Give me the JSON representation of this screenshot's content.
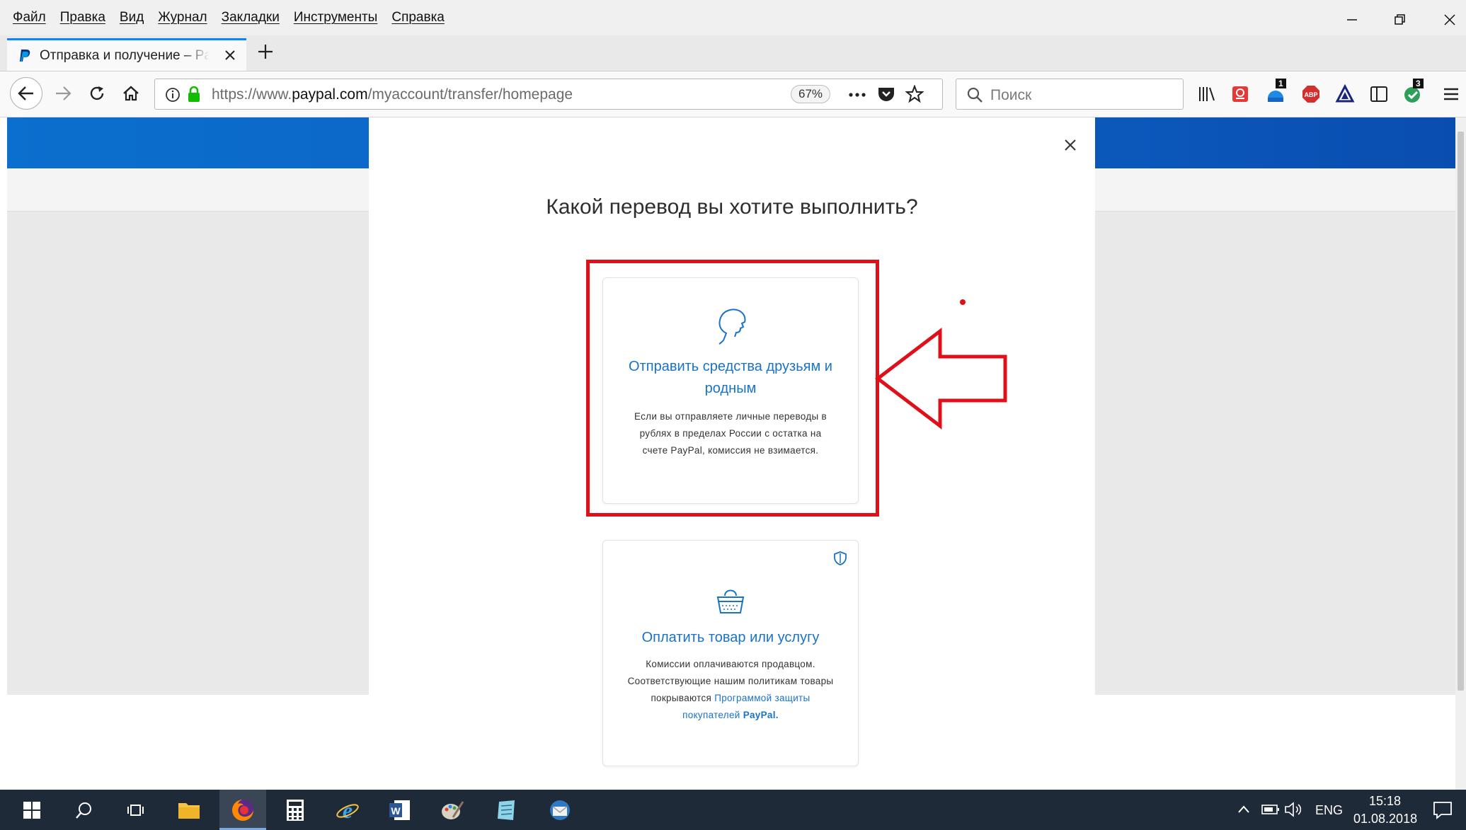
{
  "menu": {
    "items": [
      "Файл",
      "Правка",
      "Вид",
      "Журнал",
      "Закладки",
      "Инструменты",
      "Справка"
    ]
  },
  "tab": {
    "title": "Отправка и получение – PayPal"
  },
  "navbar": {
    "url_prefix": "https://www.",
    "url_domain": "paypal.com",
    "url_path": "/myaccount/transfer/homepage",
    "zoom": "67%",
    "search_placeholder": "Поиск",
    "badges": {
      "ext1": "1",
      "ext2": "3"
    }
  },
  "modal": {
    "title": "Какой перевод вы хотите выполнить?",
    "card_friends": {
      "title": "Отправить средства друзьям и родным",
      "description": "Если вы отправляете личные переводы в рублях в пределах России с остатка на счете PayPal, комиссия не взимается."
    },
    "card_goods": {
      "title": "Оплатить товар или услугу",
      "description": "Комиссии оплачиваются продавцом. Соответствующие нашим политикам товары покрываются",
      "link_text": "Программой защиты покупателей",
      "brand_text": "PayPal."
    }
  },
  "taskbar": {
    "language": "ENG",
    "time": "15:18",
    "date": "01.08.2018"
  },
  "colors": {
    "paypal_blue": "#1973c9",
    "annotation_red": "#e0101a",
    "band_blue": "#0c5fc2"
  }
}
